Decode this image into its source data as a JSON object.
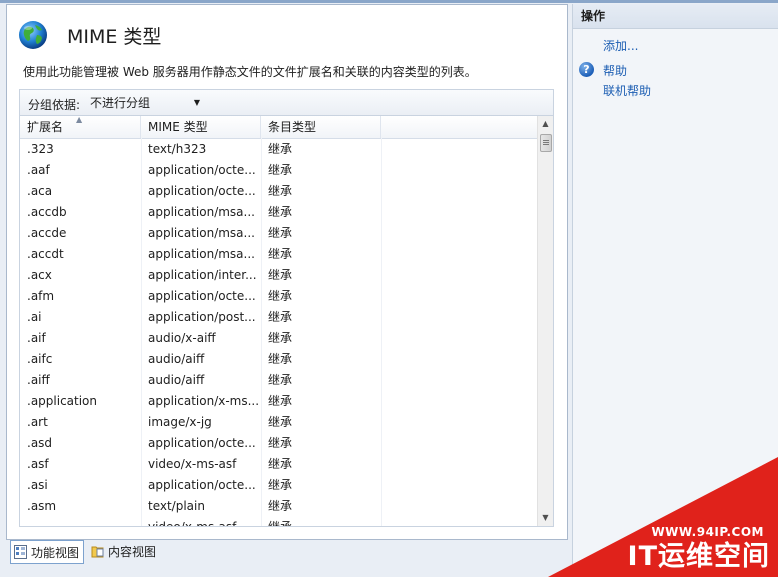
{
  "page": {
    "title": "MIME 类型",
    "description": "使用此功能管理被 Web 服务器用作静态文件的文件扩展名和关联的内容类型的列表。"
  },
  "grouping": {
    "label": "分组依据:",
    "selected": "不进行分组"
  },
  "table": {
    "columns": [
      "扩展名",
      "MIME 类型",
      "条目类型"
    ],
    "rows": [
      [
        ".323",
        "text/h323",
        "继承"
      ],
      [
        ".aaf",
        "application/octe...",
        "继承"
      ],
      [
        ".aca",
        "application/octe...",
        "继承"
      ],
      [
        ".accdb",
        "application/msa...",
        "继承"
      ],
      [
        ".accde",
        "application/msa...",
        "继承"
      ],
      [
        ".accdt",
        "application/msa...",
        "继承"
      ],
      [
        ".acx",
        "application/inter...",
        "继承"
      ],
      [
        ".afm",
        "application/octe...",
        "继承"
      ],
      [
        ".ai",
        "application/post...",
        "继承"
      ],
      [
        ".aif",
        "audio/x-aiff",
        "继承"
      ],
      [
        ".aifc",
        "audio/aiff",
        "继承"
      ],
      [
        ".aiff",
        "audio/aiff",
        "继承"
      ],
      [
        ".application",
        "application/x-ms...",
        "继承"
      ],
      [
        ".art",
        "image/x-jg",
        "继承"
      ],
      [
        ".asd",
        "application/octe...",
        "继承"
      ],
      [
        ".asf",
        "video/x-ms-asf",
        "继承"
      ],
      [
        ".asi",
        "application/octe...",
        "继承"
      ],
      [
        ".asm",
        "text/plain",
        "继承"
      ],
      [
        "",
        "video/x-ms-asf",
        "继承"
      ]
    ]
  },
  "actions": {
    "header": "操作",
    "add": "添加...",
    "help": "帮助",
    "online_help": "联机帮助"
  },
  "views": {
    "features": "功能视图",
    "content": "内容视图"
  },
  "watermark": {
    "url": "WWW.94IP.COM",
    "brand": "IT运维空间"
  },
  "colors": {
    "link": "#1e5fb3",
    "watermark": "#e0221b"
  }
}
